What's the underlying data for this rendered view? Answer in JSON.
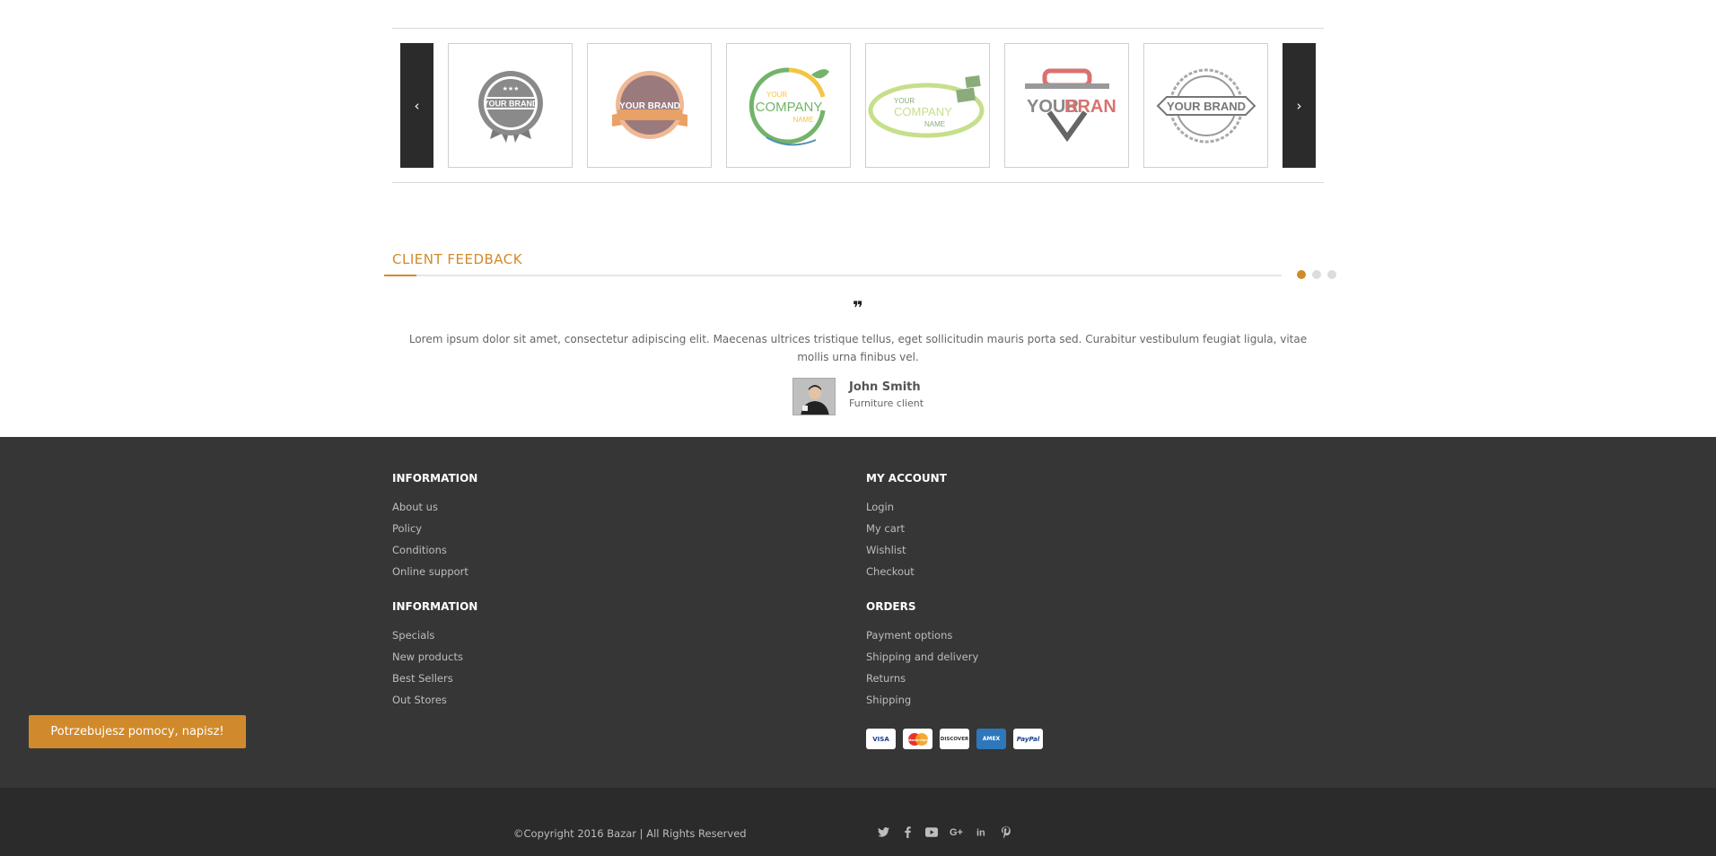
{
  "brands": {
    "prev_label": "‹",
    "next_label": "›",
    "logos": [
      {
        "line1": "YOUR BRAND",
        "style": "badge-gray"
      },
      {
        "line1": "YOUR BRAND",
        "style": "badge-mauve"
      },
      {
        "line1": "YOUR",
        "line2": "COMPANY",
        "line3": "NAME",
        "style": "leaf-green"
      },
      {
        "line1": "YOUR",
        "line2": "COMPANY",
        "line3": "NAME",
        "style": "swoosh-green"
      },
      {
        "line1": "YOUR",
        "line2": "BRAND",
        "style": "shield-red"
      },
      {
        "line1": "YOUR BRAND",
        "style": "badge-outline"
      }
    ]
  },
  "feedback": {
    "title": "CLIENT FEEDBACK",
    "quote_mark": "❞",
    "text": "Lorem ipsum dolor sit amet, consectetur adipiscing elit. Maecenas ultrices tristique tellus, eget sollicitudin mauris porta sed. Curabitur vestibulum feugiat ligula, vitae mollis urna finibus vel.",
    "name": "John Smith",
    "role": "Furniture client",
    "dots": 3,
    "active_dot": 0
  },
  "footer": {
    "col1": {
      "title": "INFORMATION",
      "items": [
        "About us",
        "Policy",
        "Conditions",
        "Online support"
      ]
    },
    "col2": {
      "title": "MY ACCOUNT",
      "items": [
        "Login",
        "My cart",
        "Wishlist",
        "Checkout"
      ]
    },
    "col3": {
      "title": "INFORMATION",
      "items": [
        "Specials",
        "New products",
        "Best Sellers",
        "Out Stores"
      ]
    },
    "col4": {
      "title": "ORDERS",
      "items": [
        "Payment options",
        "Shipping and delivery",
        "Returns",
        "Shipping"
      ]
    },
    "payments": [
      "VISA",
      "MasterCard",
      "DISCOVER",
      "AMEX",
      "PayPal"
    ],
    "help_button": "Potrzebujesz pomocy, napisz!",
    "copyright": "©Copyright 2016 Bazar | All Rights Reserved",
    "social": [
      "twitter-icon",
      "facebook-icon",
      "youtube-icon",
      "google-plus-icon",
      "linkedin-icon",
      "pinterest-icon"
    ]
  },
  "colors": {
    "accent": "#d18a2b",
    "footer_bg": "#363636",
    "subfooter_bg": "#2b2b2b"
  }
}
